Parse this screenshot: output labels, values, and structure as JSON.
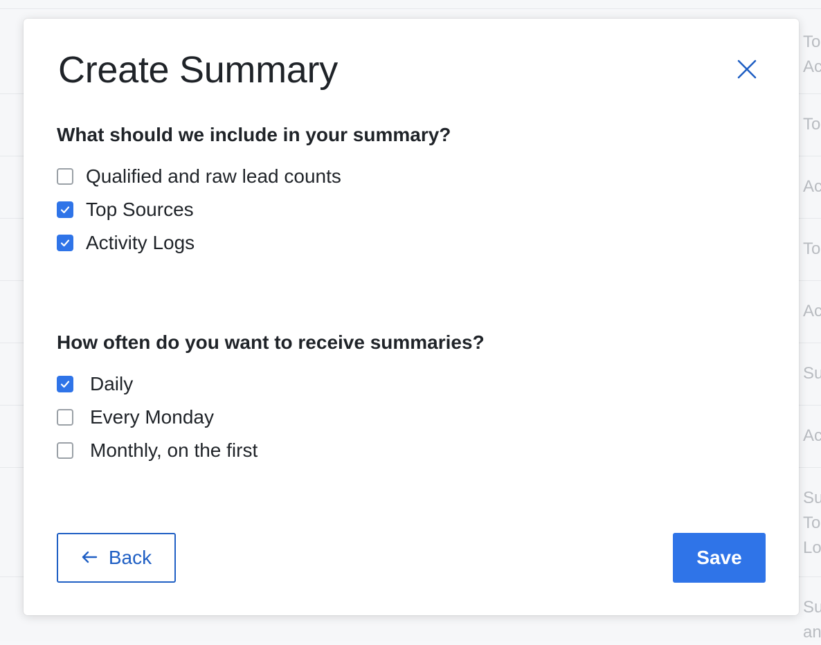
{
  "background": {
    "rows": [
      {
        "lines": [
          "To",
          "Ac"
        ]
      },
      {
        "lines": [
          "To"
        ]
      },
      {
        "lines": [
          "Ac"
        ]
      },
      {
        "lines": [
          "To"
        ]
      },
      {
        "lines": [
          "Ac"
        ]
      },
      {
        "lines": [
          "Su"
        ]
      },
      {
        "lines": [
          "Ac"
        ]
      },
      {
        "lines": [
          "Su",
          "To",
          "Lo"
        ]
      },
      {
        "lines": [
          "Su",
          "an"
        ]
      }
    ]
  },
  "modal": {
    "title": "Create Summary",
    "close_icon": "close-icon",
    "include_section": {
      "heading": "What should we include in your summary?",
      "options": [
        {
          "label": "Qualified and raw lead counts",
          "checked": false
        },
        {
          "label": "Top Sources",
          "checked": true
        },
        {
          "label": "Activity Logs",
          "checked": true
        }
      ]
    },
    "frequency_section": {
      "heading": "How often do you want to receive summaries?",
      "options": [
        {
          "label": "Daily",
          "checked": true
        },
        {
          "label": "Every Monday",
          "checked": false
        },
        {
          "label": "Monthly, on the first",
          "checked": false
        }
      ]
    },
    "back_button": {
      "label": "Back",
      "icon": "arrow-left-icon"
    },
    "save_button": {
      "label": "Save"
    }
  },
  "colors": {
    "accent": "#2f74e8",
    "link": "#1f5fc4",
    "text": "#1f2328",
    "muted_text": "#b9bcc1"
  }
}
